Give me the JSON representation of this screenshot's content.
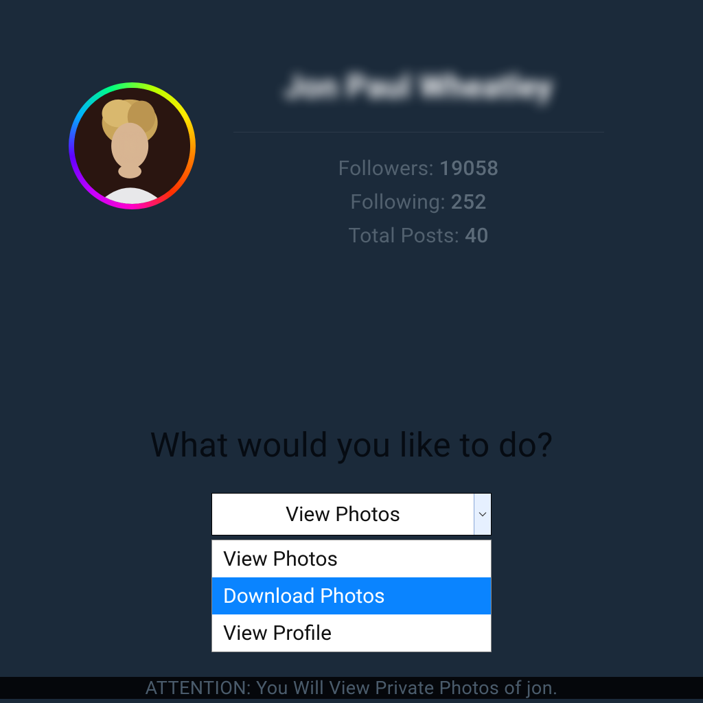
{
  "profile": {
    "name": "Jon Paul Wheatley",
    "stats": {
      "followers_label": "Followers:",
      "followers": "19058",
      "following_label": "Following:",
      "following": "252",
      "posts_label": "Total Posts:",
      "posts": "40"
    }
  },
  "prompt": {
    "question": "What would you like to do?"
  },
  "select": {
    "current": "View Photos",
    "options": {
      "opt1": "View Photos",
      "opt2": "Download Photos",
      "opt3": "View Profile"
    }
  },
  "attention": "ATTENTION: You Will View Private Photos of jon."
}
